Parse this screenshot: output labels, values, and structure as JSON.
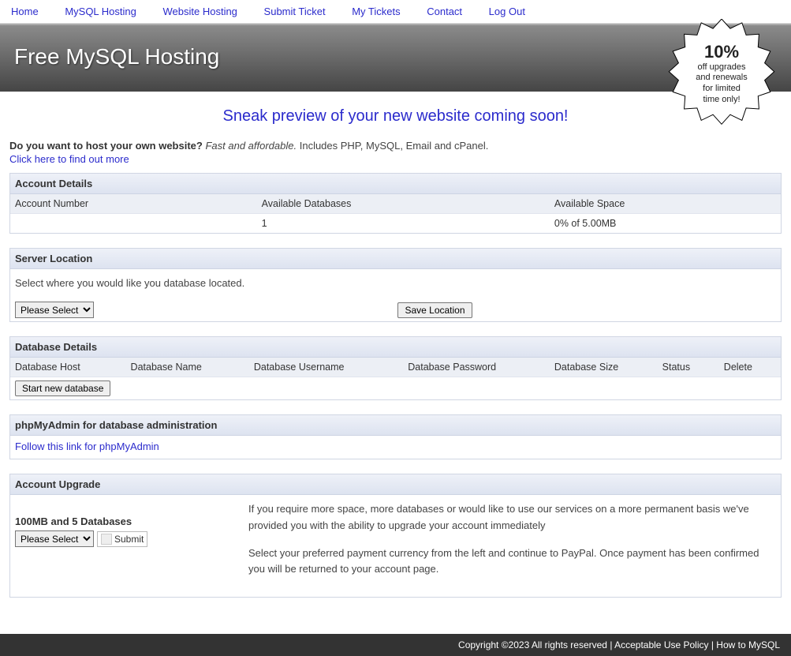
{
  "nav": {
    "home": "Home",
    "mysql": "MySQL Hosting",
    "website": "Website Hosting",
    "submit": "Submit Ticket",
    "tickets": "My Tickets",
    "contact": "Contact",
    "logout": "Log Out"
  },
  "header": {
    "title": "Free MySQL Hosting"
  },
  "starburst": {
    "big": "10%",
    "l1": "off upgrades",
    "l2": "and renewals",
    "l3": "for limited",
    "l4": "time only!"
  },
  "preview": "Sneak preview of your new website coming soon!",
  "host_own": {
    "q": "Do you want to host your own website?",
    "tag": "Fast and affordable.",
    "rest": " Includes PHP, MySQL, Email and cPanel.",
    "link": "Click here to find out more"
  },
  "account_details": {
    "title": "Account Details",
    "cols": {
      "num": "Account Number",
      "avail": "Available Databases",
      "space": "Available Space"
    },
    "row": {
      "num": "",
      "avail": "1",
      "space": "0% of 5.00MB"
    }
  },
  "server_location": {
    "title": "Server Location",
    "desc": "Select where you would like you database located.",
    "select": "Please Select",
    "save": "Save Location"
  },
  "db_details": {
    "title": "Database Details",
    "cols": {
      "host": "Database Host",
      "name": "Database Name",
      "user": "Database Username",
      "pass": "Database Password",
      "size": "Database Size",
      "status": "Status",
      "del": "Delete"
    },
    "start": "Start new database"
  },
  "phpmyadmin": {
    "title": "phpMyAdmin for database administration",
    "link": "Follow this link for phpMyAdmin"
  },
  "upgrade": {
    "title": "Account Upgrade",
    "left_title": "100MB and 5 Databases",
    "select": "Please Select",
    "submit": "Submit",
    "p1": "If you require more space, more databases or would like to use our services on a more permanent basis we've provided you with the ability to upgrade your account immediately",
    "p2": "Select your preferred payment currency from the left and continue to PayPal. Once payment has been confirmed you will be returned to your account page."
  },
  "footer": {
    "copy": "Copyright ©2023 All rights reserved",
    "aup": "Acceptable Use Policy",
    "how": "How to MySQL"
  }
}
